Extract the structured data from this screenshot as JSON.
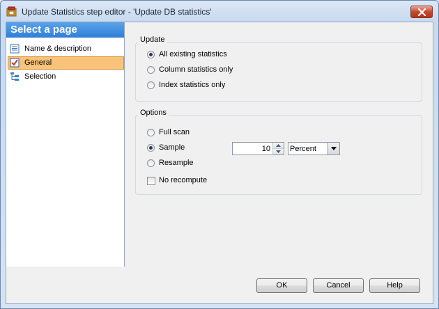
{
  "window": {
    "title": "Update Statistics step editor - 'Update DB statistics'"
  },
  "nav": {
    "header": "Select a page",
    "items": [
      {
        "label": "Name & description",
        "icon": "document-icon",
        "selected": false
      },
      {
        "label": "General",
        "icon": "checklist-icon",
        "selected": true
      },
      {
        "label": "Selection",
        "icon": "tree-icon",
        "selected": false
      }
    ]
  },
  "update_group": {
    "title": "Update",
    "options": [
      {
        "label": "All existing statistics",
        "checked": true
      },
      {
        "label": "Column statistics only",
        "checked": false
      },
      {
        "label": "Index statistics only",
        "checked": false
      }
    ]
  },
  "options_group": {
    "title": "Options",
    "radios": [
      {
        "label": "Full scan",
        "checked": false
      },
      {
        "label": "Sample",
        "checked": true
      },
      {
        "label": "Resample",
        "checked": false
      }
    ],
    "sample_value": "10",
    "sample_unit": "Percent",
    "no_recompute": {
      "label": "No recompute",
      "checked": false
    }
  },
  "buttons": {
    "ok": "OK",
    "cancel": "Cancel",
    "help": "Help"
  },
  "colors": {
    "nav_header": "#2f7fd8",
    "nav_selected": "#f9c37a",
    "close_button": "#c7452d"
  }
}
